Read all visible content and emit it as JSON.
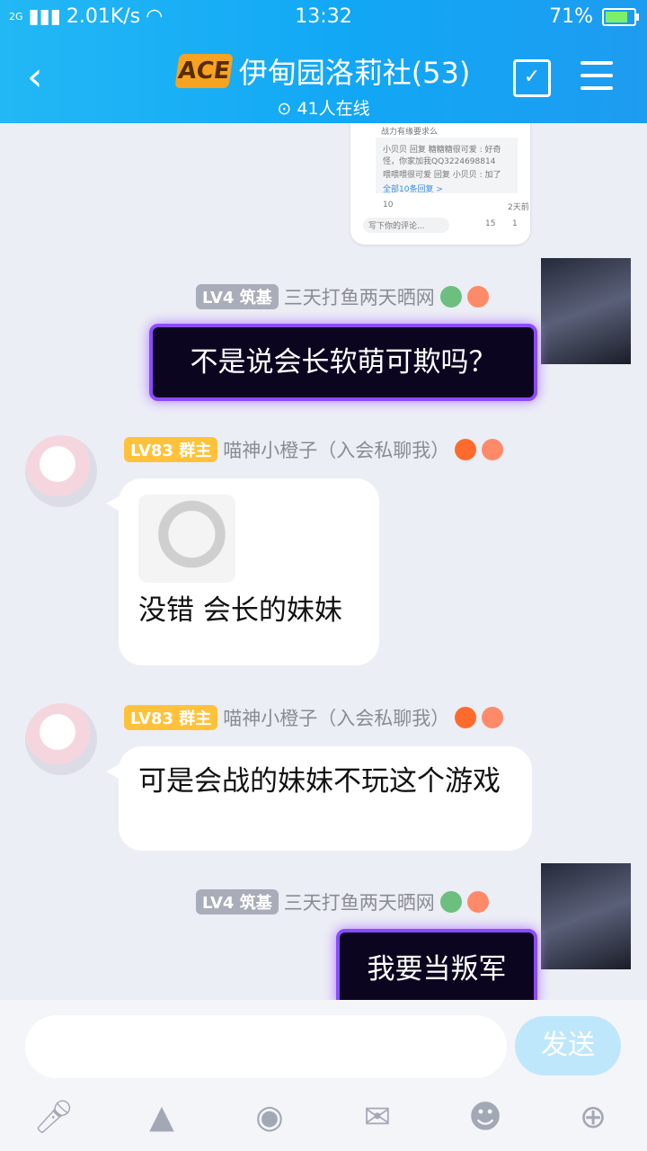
{
  "status": {
    "signal": "2G",
    "speed": "2.01K/s",
    "time": "13:32",
    "battery": "71%",
    "battery_level": 0.71
  },
  "header": {
    "logo_text": "ACE",
    "title": "伊甸园洛莉社(53)",
    "online": "41人在线",
    "back_icon": "chevron-left-icon",
    "calendar_icon": "calendar-check-icon",
    "menu_icon": "menu-icon"
  },
  "shared_post": {
    "line1": "战力有缘要求么",
    "reply1": "小贝贝 回复 糖糖糖很可爱 : 好奇怪，你家加我QQ3224698814",
    "reply2": "喂喂喂很可爱 回复 小贝贝 : 加了",
    "more": "全部10条回复 >",
    "count1": "10",
    "time": "2天前",
    "comment_placeholder": "写下你的评论...",
    "count2": "15",
    "count3": "1"
  },
  "messages": [
    {
      "level": "LV4",
      "role": "筑基",
      "name": "三天打鱼两天晒网",
      "text": "不是说会长软萌可欺吗？"
    },
    {
      "level": "LV83",
      "role": "群主",
      "name": "喵神小橙子（入会私聊我）",
      "text": "没错 会长的妹妹"
    },
    {
      "level": "LV83",
      "role": "群主",
      "name": "喵神小橙子（入会私聊我）",
      "text": "可是会战的妹妹不玩这个游戏"
    },
    {
      "level": "LV4",
      "role": "筑基",
      "name": "三天打鱼两天晒网",
      "text": "我要当叛军"
    }
  ],
  "input": {
    "placeholder": "",
    "send": "发送"
  },
  "toolbar": {
    "icons": [
      "microphone-icon",
      "image-icon",
      "camera-icon",
      "red-packet-icon",
      "emoji-icon",
      "plus-icon"
    ]
  }
}
